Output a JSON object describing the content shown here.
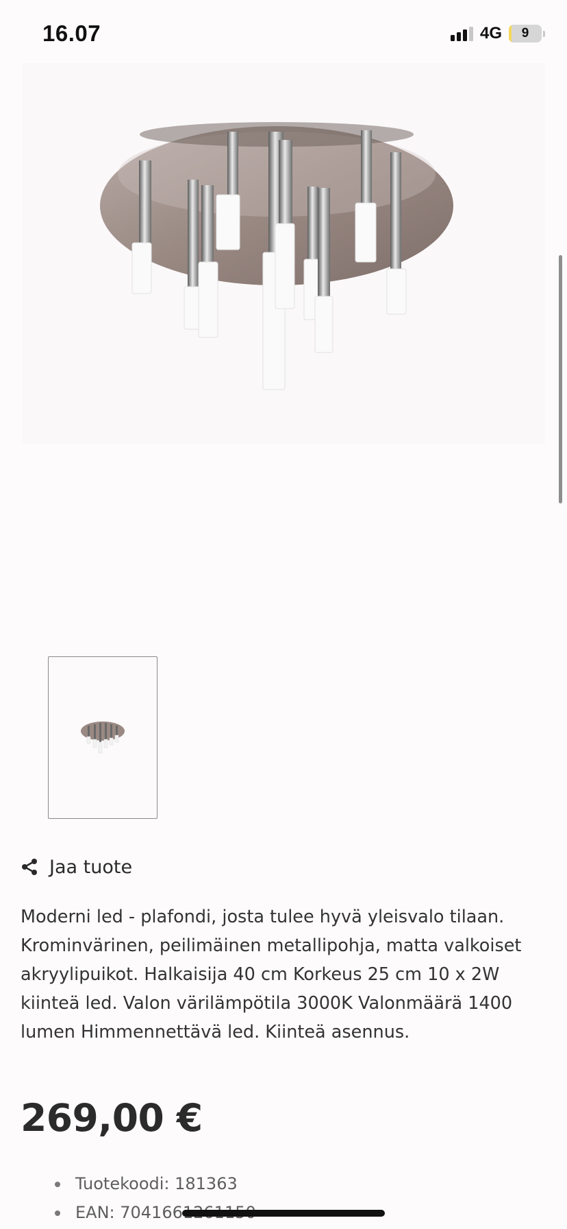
{
  "status_bar": {
    "time": "16.07",
    "network": "4G",
    "battery_level": "9",
    "battery_percent": 9,
    "battery_color": "#f5d75c"
  },
  "product": {
    "share_label": "Jaa tuote",
    "description": "Moderni led - plafondi, josta tulee hyvä yleisvalo tilaan. Krominvärinen, peilimäinen metallipohja, matta valkoiset akryylipuikot. Halkaisija 40 cm Korkeus 25 cm 10 x 2W kiinteä led. Valon värilämpötila 3000K Valonmäärä 1400 lumen Himmennettävä led. Kiinteä asennus.",
    "price": "269,00 €",
    "details": [
      "Tuotekoodi: 181363",
      "EAN: 7041661261150"
    ]
  },
  "icons": {
    "share": "share-icon",
    "signal": "cellular-signal-icon",
    "battery": "battery-icon"
  },
  "colors": {
    "background": "#fdfbfc",
    "text": "#2b2b2b",
    "muted_text": "#5e5e5e"
  }
}
